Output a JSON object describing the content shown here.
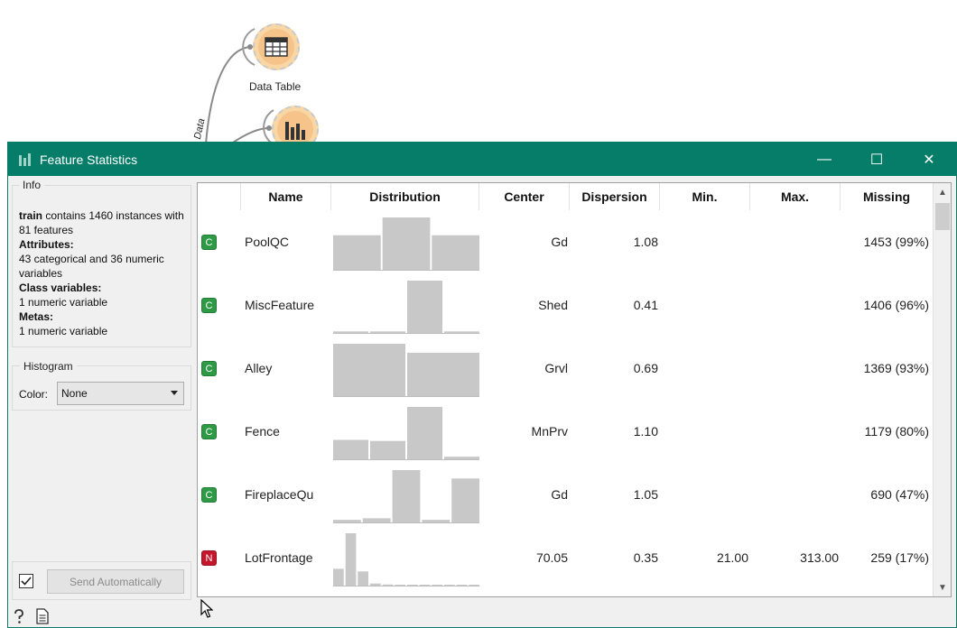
{
  "canvas": {
    "nodes": [
      {
        "label": "Data Table",
        "icon": "table-icon"
      },
      {
        "label": "",
        "icon": "bar-chart-icon"
      }
    ],
    "link_label": "Data"
  },
  "window": {
    "title": "Feature Statistics",
    "controls": {
      "minimize": "—",
      "maximize": "☐",
      "close": "✕"
    }
  },
  "info": {
    "title": "Info",
    "dataset_name": "train",
    "line1_rest": " contains 1460 instances with 81 features",
    "attributes_label": "Attributes:",
    "attributes_value": "43 categorical and 36 numeric variables",
    "class_label": "Class variables:",
    "class_value": "1 numeric variable",
    "metas_label": "Metas:",
    "metas_value": "1 numeric variable"
  },
  "histogram": {
    "title": "Histogram",
    "color_label": "Color:",
    "color_value": "None"
  },
  "send": {
    "checked": true,
    "label": "Send Automatically"
  },
  "table": {
    "columns": [
      "Name",
      "Distribution",
      "Center",
      "Dispersion",
      "Min.",
      "Max.",
      "Missing"
    ],
    "rows": [
      {
        "type": "C",
        "name": "PoolQC",
        "center": "Gd",
        "dispersion": "1.08",
        "min": "",
        "max": "",
        "missing": "1453 (99%)",
        "hist": [
          0.66,
          1.0,
          0.66
        ]
      },
      {
        "type": "C",
        "name": "MiscFeature",
        "center": "Shed",
        "dispersion": "0.41",
        "min": "",
        "max": "",
        "missing": "1406 (96%)",
        "hist": [
          0.03,
          0.03,
          1.0,
          0.03
        ]
      },
      {
        "type": "C",
        "name": "Alley",
        "center": "Grvl",
        "dispersion": "0.69",
        "min": "",
        "max": "",
        "missing": "1369 (93%)",
        "hist": [
          1.0,
          0.83
        ]
      },
      {
        "type": "C",
        "name": "Fence",
        "center": "MnPrv",
        "dispersion": "1.10",
        "min": "",
        "max": "",
        "missing": "1179 (80%)",
        "hist": [
          0.37,
          0.35,
          1.0,
          0.05
        ]
      },
      {
        "type": "C",
        "name": "FireplaceQu",
        "center": "Gd",
        "dispersion": "1.05",
        "min": "",
        "max": "",
        "missing": "690 (47%)",
        "hist": [
          0.05,
          0.08,
          1.0,
          0.05,
          0.84
        ]
      },
      {
        "type": "N",
        "name": "LotFrontage",
        "center": "70.05",
        "dispersion": "0.35",
        "min": "21.00",
        "max": "313.00",
        "missing": "259 (17%)",
        "hist": [
          0.32,
          1.0,
          0.27,
          0.04,
          0.02,
          0.01,
          0.01,
          0.01,
          0.01,
          0.01,
          0.01,
          0.01
        ]
      }
    ]
  },
  "colors": {
    "titlebar": "#067d69",
    "categorical_badge": "#2e9a46",
    "numeric_badge": "#c4172c",
    "hist_bar": "#c8c8c8",
    "node_fill": "#f6c48a"
  },
  "status_icons": [
    "help-icon",
    "report-icon"
  ]
}
